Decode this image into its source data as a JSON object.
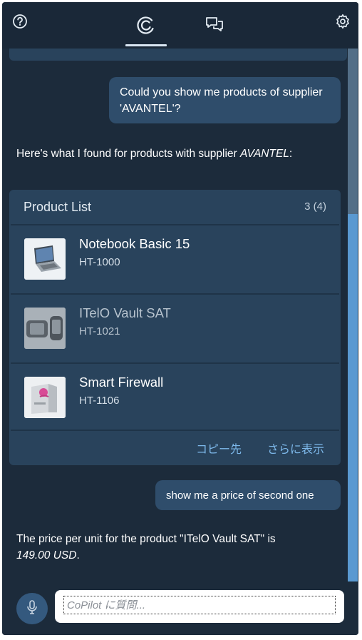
{
  "header": {
    "help_icon": "help-circle-icon",
    "copilot_tab_icon": "copilot-icon",
    "chat_tab_icon": "chat-bubbles-icon",
    "settings_icon": "gear-icon",
    "active_tab": "copilot"
  },
  "messages": {
    "user_1": "Could you show me products of supplier 'AVANTEL'?",
    "bot_1_prefix": "Here's what I found for products with supplier ",
    "bot_1_supplier": "AVANTEL",
    "bot_1_suffix": ":",
    "user_2": "show me a price of second one",
    "bot_2_prefix": "The price per unit for the product \"ITelO Vault SAT\" is ",
    "bot_2_price": "149.00 USD",
    "bot_2_suffix": "."
  },
  "product_list": {
    "title": "Product List",
    "count": "3 (4)",
    "items": [
      {
        "name": "Notebook Basic 15",
        "id": "HT-1000",
        "thumb": "laptop-image"
      },
      {
        "name": "ITelO Vault SAT",
        "id": "HT-1021",
        "thumb": "phone-image"
      },
      {
        "name": "Smart Firewall",
        "id": "HT-1106",
        "thumb": "software-box-image"
      }
    ],
    "copy_link": "コピー先",
    "more_link": "さらに表示"
  },
  "footer": {
    "mic_icon": "microphone-icon",
    "input_placeholder": "CoPilot に質問...",
    "input_value": ""
  },
  "colors": {
    "panel_bg": "#1c2b3b",
    "card_bg": "#29435c",
    "user_bubble": "#2f4d6b",
    "link": "#7db8ea",
    "scroll_thumb": "#5a99d1"
  }
}
